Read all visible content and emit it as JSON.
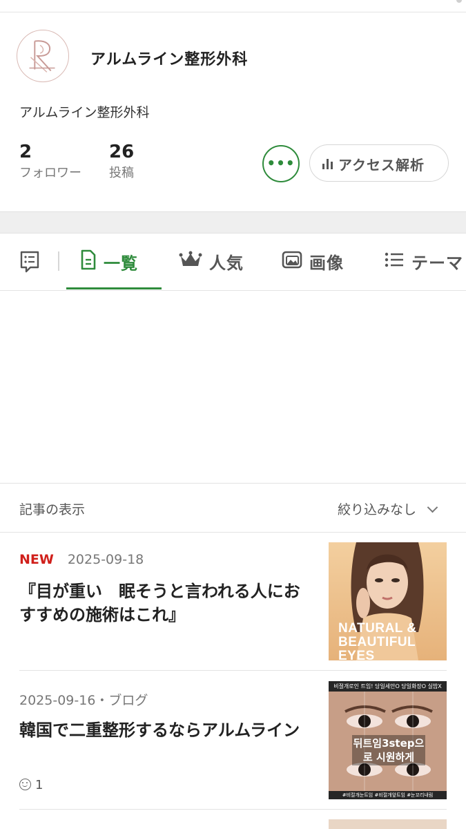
{
  "profile": {
    "blog_name": "アルムライン整形外科",
    "description": "アルムライン整形外科",
    "followers_count": "2",
    "followers_label": "フォロワー",
    "posts_count": "26",
    "posts_label": "投稿",
    "more_label": "•••",
    "access_label": "アクセス解析"
  },
  "tabs": [
    {
      "label": "一覧",
      "active": true,
      "icon": "document-icon"
    },
    {
      "label": "人気",
      "active": false,
      "icon": "crown-icon"
    },
    {
      "label": "画像",
      "active": false,
      "icon": "images-icon"
    },
    {
      "label": "テーマ",
      "active": false,
      "icon": "list-icon"
    }
  ],
  "filter": {
    "label": "記事の表示",
    "selected": "絞り込みなし"
  },
  "posts": [
    {
      "badge": "NEW",
      "meta": "2025-09-18",
      "title": "『目が重い　眠そうと言われる人におすすめの施術はこれ』",
      "thumb_caption": "NATURAL & BEAUTIFUL EYES"
    },
    {
      "meta": "2025-09-16・ブログ",
      "title": "韓国で二重整形するならアルムライン",
      "likes": "1",
      "thumb_caption": "뒤트임3step으로 시원하게",
      "thumb_top": "비절개로인 트임! 당일세안O 당일화장O 실밥X",
      "thumb_bottom": "#비절개눈트임 #비절개앞트임 #눈꼬리내림"
    }
  ],
  "colors": {
    "accent": "#2e8b3b",
    "new_badge": "#d0201b"
  }
}
